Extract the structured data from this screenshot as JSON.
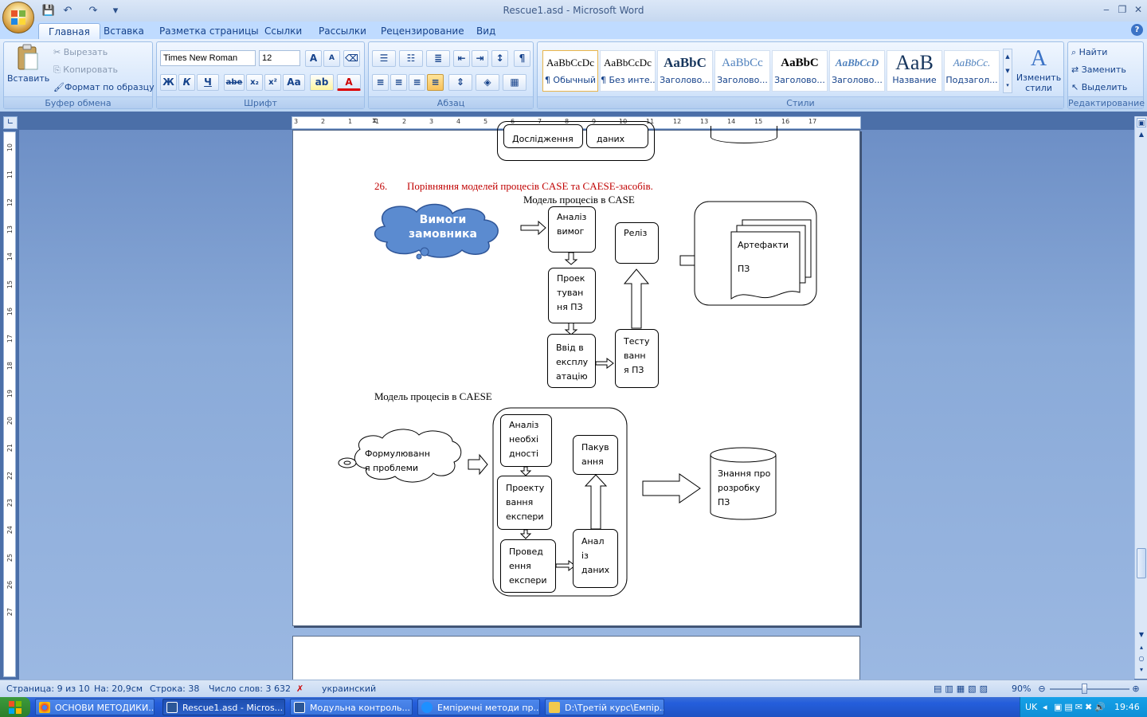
{
  "window": {
    "title": "Rescue1.asd - Microsoft Word",
    "minimize": "‒",
    "restore": "❐",
    "close": "✕"
  },
  "quick_access": {
    "save": "💾",
    "undo": "↶",
    "redo": "↷",
    "customize": "▾"
  },
  "tabs": [
    "Главная",
    "Вставка",
    "Разметка страницы",
    "Ссылки",
    "Рассылки",
    "Рецензирование",
    "Вид"
  ],
  "help": "?",
  "clipboard": {
    "paste": "Вставить",
    "cut": "Вырезать",
    "copy": "Копировать",
    "format_painter": "Формат по образцу",
    "label": "Буфер обмена"
  },
  "font": {
    "name": "Times New Roman",
    "size": "12",
    "label": "Шрифт",
    "bold": "Ж",
    "italic": "К",
    "underline": "Ч",
    "strike": "abe",
    "sub": "x₂",
    "sup": "x²",
    "case": "Aa",
    "grow": "A",
    "shrink": "A"
  },
  "paragraph": {
    "label": "Абзац",
    "pilcrow": "¶"
  },
  "styles": {
    "label": "Стили",
    "items": [
      {
        "sample": "AaBbCcDc",
        "name": "¶ Обычный"
      },
      {
        "sample": "AaBbCcDc",
        "name": "¶ Без инте..."
      },
      {
        "sample": "AaBbC",
        "name": "Заголово..."
      },
      {
        "sample": "AaBbCc",
        "name": "Заголово..."
      },
      {
        "sample": "AaBbC",
        "name": "Заголово..."
      },
      {
        "sample": "AaBbCcD",
        "name": "Заголово..."
      },
      {
        "sample": "AaB",
        "name": "Название"
      },
      {
        "sample": "AaBbCc.",
        "name": "Подзагол..."
      }
    ],
    "change": "Изменить стили"
  },
  "editing": {
    "label": "Редактирование",
    "find": "Найти",
    "replace": "Заменить",
    "select": "Выделить"
  },
  "ruler": {
    "ticks": [
      "3",
      "2",
      "1",
      "1",
      "2",
      "3",
      "4",
      "5",
      "6",
      "7",
      "8",
      "9",
      "10",
      "11",
      "12",
      "13",
      "14",
      "15",
      "16",
      "17"
    ],
    "v_ticks": [
      "10",
      "11",
      "12",
      "13",
      "14",
      "15",
      "16",
      "17",
      "18",
      "19",
      "20",
      "21",
      "22",
      "23",
      "24",
      "25",
      "26",
      "27"
    ]
  },
  "document": {
    "top_fragment": {
      "left": "Дослідження",
      "right": "даних"
    },
    "heading_number": "26.",
    "heading": "Порівняння моделей процесів CASE та CAESE-засобів.",
    "case_title": "Модель процесів в CASE",
    "cloud_case": "Вимоги замовника",
    "case_boxes": {
      "analysis": "Аналіз\nвимог",
      "design": "Проек\nтуван\nня ПЗ",
      "deploy": "Ввід в\nексплу\nатацію",
      "release": "Реліз",
      "testing": "Тесту\nванн\nя ПЗ",
      "artifacts": "Артефакти\n\nПЗ"
    },
    "caese_title": "Модель процесів в CAESE",
    "cloud_caese": "Формулюванн\nя проблеми",
    "caese_boxes": {
      "needs": "Аналіз\nнеобхі\nдності",
      "design_exp": "Проекту\nвання\nекспери",
      "conduct": "Провед\nення\nекспери",
      "packaging": "Пакув\nання",
      "data_analysis": "Анал\nіз\nданих",
      "knowledge": "Знання про\nрозробку\nПЗ"
    }
  },
  "status": {
    "page": "Страница: 9 из 10",
    "position": "На: 20,9см",
    "line": "Строка: 38",
    "words": "Число слов: 3 632",
    "language": "украинский",
    "zoom": "90%"
  },
  "taskbar": {
    "items": [
      "ОСНОВИ МЕТОДИКИ...",
      "Rescue1.asd - Micros...",
      "Модульна контроль...",
      "Емпіричні методи пр...",
      "D:\\Третій курс\\Емпір..."
    ],
    "lang": "UK",
    "clock": "19:46"
  }
}
